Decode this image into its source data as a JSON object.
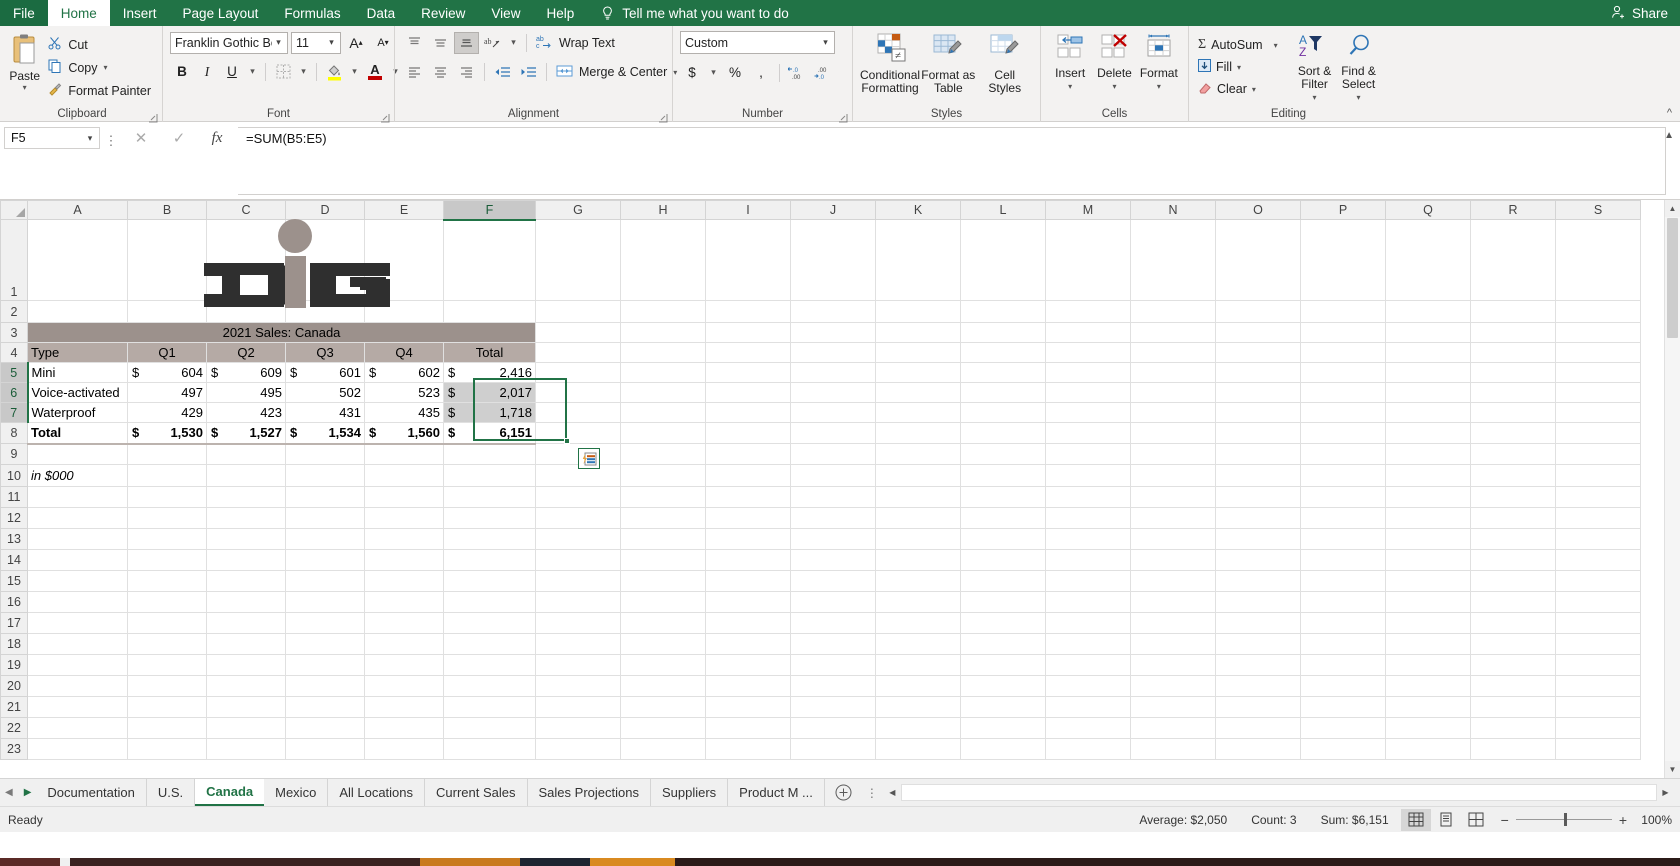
{
  "app": {
    "ribbon_tabs": [
      "File",
      "Home",
      "Insert",
      "Page Layout",
      "Formulas",
      "Data",
      "Review",
      "View",
      "Help"
    ],
    "active_tab": "Home",
    "tellme": "Tell me what you want to do",
    "share_label": "Share"
  },
  "ribbon": {
    "clipboard": {
      "group_label": "Clipboard",
      "paste_label": "Paste",
      "cut_label": "Cut",
      "copy_label": "Copy",
      "format_painter_label": "Format Painter"
    },
    "font": {
      "group_label": "Font",
      "font_name": "Franklin Gothic Boo",
      "font_size": "11",
      "grow_label": "A",
      "shrink_label": "A",
      "bold_label": "B",
      "italic_label": "I",
      "underline_label": "U"
    },
    "alignment": {
      "group_label": "Alignment",
      "wrap_text_label": "Wrap Text",
      "merge_center_label": "Merge & Center"
    },
    "number": {
      "group_label": "Number",
      "format_value": "Custom",
      "accounting_label": "$",
      "percent_label": "%",
      "comma_label": ",",
      "increase_decimal_label": ".00",
      "decrease_decimal_label": ".00"
    },
    "styles": {
      "group_label": "Styles",
      "conditional_formatting_label": "Conditional\nFormatting",
      "conditional_formatting_line1": "Conditional",
      "conditional_formatting_line2": "Formatting",
      "format_as_table_line1": "Format as",
      "format_as_table_line2": "Table",
      "cell_styles_line1": "Cell",
      "cell_styles_line2": "Styles"
    },
    "cells": {
      "group_label": "Cells",
      "insert_label": "Insert",
      "delete_label": "Delete",
      "format_label": "Format"
    },
    "editing": {
      "group_label": "Editing",
      "autosum_label": "AutoSum",
      "fill_label": "Fill",
      "clear_label": "Clear",
      "sort_filter_line1": "Sort &",
      "sort_filter_line2": "Filter",
      "find_select_line1": "Find &",
      "find_select_line2": "Select"
    }
  },
  "formula_bar": {
    "name_box": "F5",
    "formula": "=SUM(B5:E5)",
    "cancel_label": "✕",
    "enter_label": "✓",
    "fx_label": "fx"
  },
  "grid": {
    "columns": [
      "A",
      "B",
      "C",
      "D",
      "E",
      "F",
      "G",
      "H",
      "I",
      "J",
      "K",
      "L",
      "M",
      "N",
      "O",
      "P",
      "Q",
      "R",
      "S"
    ],
    "selected_column": "F",
    "rows": [
      1,
      2,
      3,
      4,
      5,
      6,
      7,
      8,
      9,
      10,
      11,
      12,
      13,
      14,
      15,
      16,
      17,
      18,
      19,
      20,
      21,
      22,
      23
    ],
    "selected_rows": [
      5,
      6,
      7
    ],
    "logo_text": "DIG",
    "title_band": "2021 Sales: Canada",
    "headers": [
      "Type",
      "Q1",
      "Q2",
      "Q3",
      "Q4",
      "Total"
    ],
    "data_rows": [
      {
        "type": "Mini",
        "q1": "604",
        "q2": "609",
        "q3": "601",
        "q4": "602",
        "total": "2,416",
        "currency": true
      },
      {
        "type": "Voice-activated",
        "q1": "497",
        "q2": "495",
        "q3": "502",
        "q4": "523",
        "total": "2,017",
        "currency": false
      },
      {
        "type": "Waterproof",
        "q1": "429",
        "q2": "423",
        "q3": "431",
        "q4": "435",
        "total": "1,718",
        "currency": false
      }
    ],
    "total_row": {
      "type": "Total",
      "q1": "1,530",
      "q2": "1,527",
      "q3": "1,534",
      "q4": "1,560",
      "total": "6,151"
    },
    "currency_symbol": "$",
    "footnote": "in $000",
    "paste_options_tooltip": "Paste Options"
  },
  "sheet_tabs": {
    "tabs": [
      "Documentation",
      "U.S.",
      "Canada",
      "Mexico",
      "All Locations",
      "Current Sales",
      "Sales Projections",
      "Suppliers",
      "Product M ..."
    ],
    "active": "Canada",
    "add_label": "+"
  },
  "status_bar": {
    "mode": "Ready",
    "average": "Average:  $2,050",
    "count": "Count: 3",
    "sum": "Sum:  $6,151",
    "zoom": "100%",
    "zoom_out": "−",
    "zoom_in": "+"
  },
  "colors": {
    "excel_green": "#217346",
    "title_band": "#9c918c",
    "header_band": "#b5aaa5",
    "logo_dark": "#2f2f2f",
    "logo_mauve": "#9c918c",
    "selection": "#217346"
  }
}
